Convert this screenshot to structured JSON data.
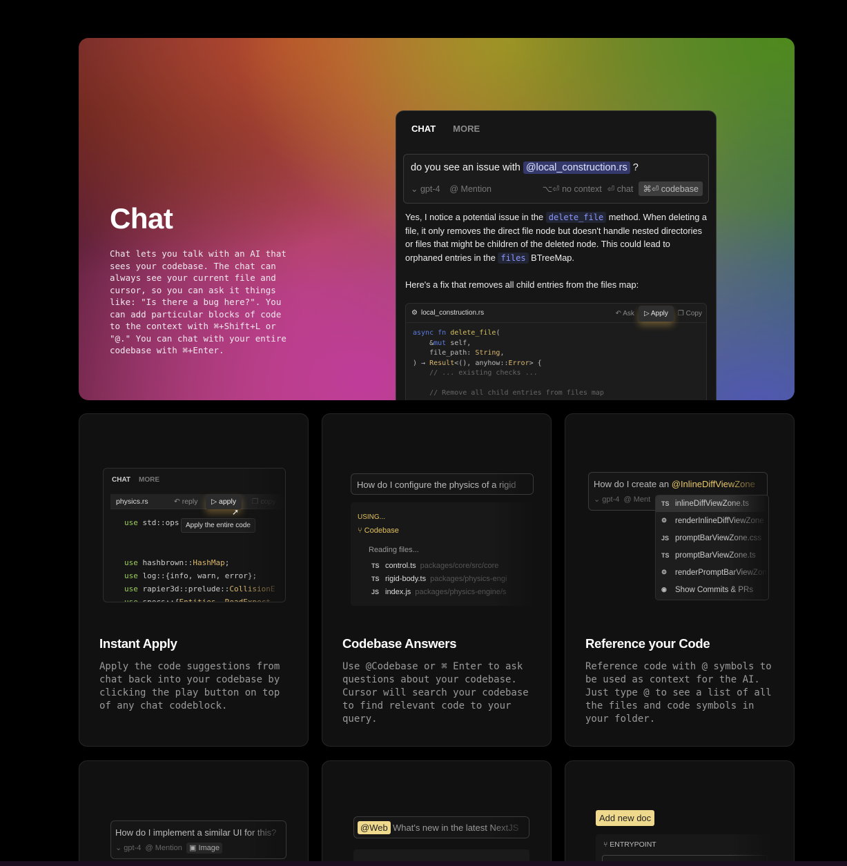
{
  "hero": {
    "title": "Chat",
    "description": "Chat lets you talk with an AI that sees your codebase. The chat can always see your current file and cursor, so you can ask it things like: \"Is there a bug here?\". You can add particular blocks of code to the context with ⌘+Shift+L or \"@.\" You can chat with your entire codebase with ⌘+Enter.",
    "panel": {
      "tab_chat": "CHAT",
      "tab_more": "MORE",
      "prompt_prefix": "do you see an issue with",
      "prompt_mention": "@local_construction.rs",
      "prompt_suffix": "?",
      "model": "gpt-4",
      "mention": "@ Mention",
      "no_context": "⌥⏎ no context",
      "chat": "⏎ chat",
      "codebase": "⌘⏎ codebase",
      "answer_1a": "Yes, I notice a potential issue in the",
      "answer_1_code": "delete_file",
      "answer_1b": "method. When deleting a file, it only removes the direct file node but doesn't handle nested directories or files that might be children of the deleted node. This could lead to orphaned entries in the",
      "answer_1_code2": "files",
      "answer_1c": "BTreeMap.",
      "answer_2": "Here's a fix that removes all child entries from the files map:",
      "code_file": "local_construction.rs",
      "ask": "Ask",
      "apply": "Apply",
      "copy": "Copy"
    }
  },
  "cards": [
    {
      "title": "Instant Apply",
      "description": "Apply the code suggestions from chat back into your codebase by clicking the play button on top of any chat codeblock.",
      "tab_chat": "CHAT",
      "tab_more": "MORE",
      "file": "physics.rs",
      "reply": "reply",
      "apply": "apply",
      "copy": "copy",
      "tooltip": "Apply the entire code"
    },
    {
      "title": "Codebase Answers",
      "description": "Use @Codebase or ⌘ Enter to ask questions about your codebase. Cursor will search your codebase to find relevant code to your query.",
      "query": "How do I configure the physics of a rigid",
      "using": "USING...",
      "codebase": "Codebase",
      "reading": "Reading files...",
      "files": [
        {
          "tag": "TS",
          "name": "control.ts",
          "path": "packages/core/src/core"
        },
        {
          "tag": "TS",
          "name": "rigid-body.ts",
          "path": "packages/physics-engi"
        },
        {
          "tag": "JS",
          "name": "index.js",
          "path": "packages/physics-engine/s"
        }
      ]
    },
    {
      "title": "Reference your Code",
      "description": "Reference code with @ symbols to be used as context for the AI. Just type @ to see a list of all the files and code symbols in your folder.",
      "query_prefix": "How do I create an",
      "query_mention": "@InlineDiffViewZone",
      "model": "gpt-4",
      "mention": "@ Ment",
      "items": [
        {
          "tag": "TS",
          "name": "inlineDiffViewZone.ts"
        },
        {
          "tag": "gear",
          "name": "renderInlineDiffViewZone"
        },
        {
          "tag": "JS",
          "name": "promptBarViewZone.css"
        },
        {
          "tag": "TS",
          "name": "promptBarViewZone.ts"
        },
        {
          "tag": "gear",
          "name": "renderPromptBarViewZon"
        },
        {
          "tag": "eye",
          "name": "Show Commits & PRs"
        }
      ]
    }
  ],
  "bottom_cards": [
    {
      "query": "How do I implement a similar UI for this?",
      "model": "gpt-4",
      "mention": "@ Mention",
      "image": "Image"
    },
    {
      "chip": "@Web",
      "query": "What's new in the latest NextJS"
    },
    {
      "button": "Add new doc",
      "label": "ENTRYPOINT"
    }
  ],
  "colors": {
    "accent_purple": "#8b95ff",
    "mention_bg": "#34386a",
    "yellow_chip": "#efd98c"
  }
}
